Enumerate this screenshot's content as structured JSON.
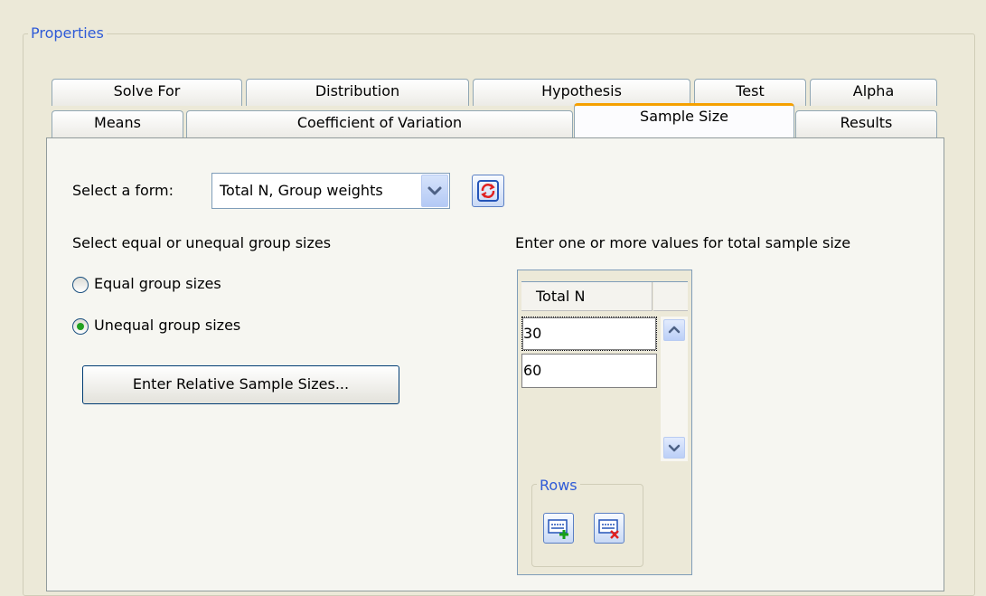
{
  "group": {
    "title": "Properties"
  },
  "tabs": {
    "back_row": [
      "Solve For",
      "Distribution",
      "Hypothesis",
      "Test",
      "Alpha"
    ],
    "front_row": [
      "Means",
      "Coefficient of Variation",
      "Sample Size",
      "Results"
    ],
    "selected": "Sample Size"
  },
  "form": {
    "label": "Select a form:",
    "selected_value": "Total N, Group weights",
    "refresh_icon": "refresh-icon"
  },
  "group_sizes": {
    "heading": "Select equal or unequal group sizes",
    "options": [
      {
        "label": "Equal group sizes",
        "checked": false
      },
      {
        "label": "Unequal group sizes",
        "checked": true
      }
    ],
    "relative_button": "Enter Relative Sample Sizes..."
  },
  "total_n": {
    "heading": "Enter one or more values for total sample size",
    "column": "Total N",
    "values": [
      "30",
      "60"
    ],
    "rows_group": "Rows",
    "add_row_icon": "add-row-icon",
    "delete_row_icon": "delete-row-icon"
  },
  "colors": {
    "background": "#ECE9D8",
    "group_title": "#2F5BD7",
    "selected_tab_accent": "#F5A000",
    "radio_dot": "#21A121"
  }
}
